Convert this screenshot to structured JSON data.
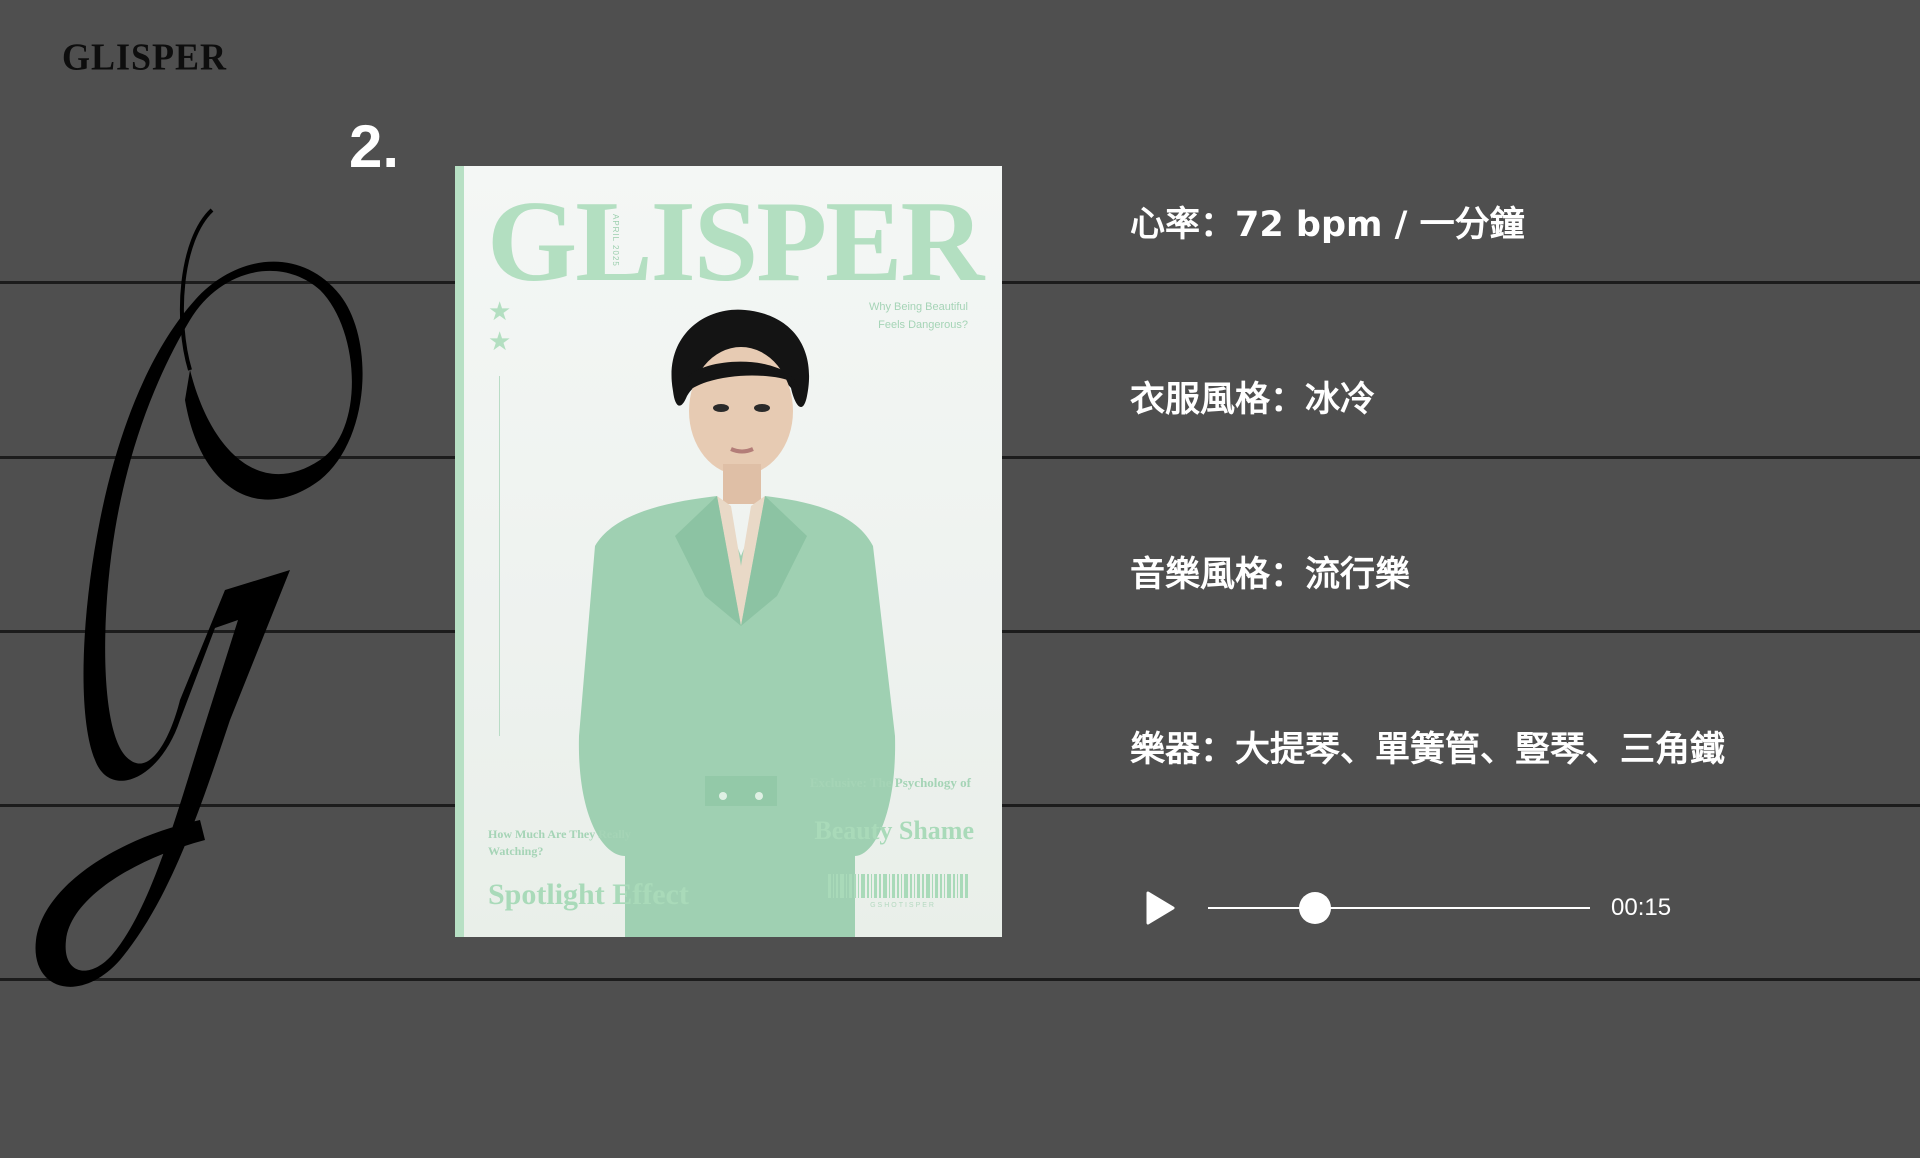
{
  "brand": "GLISPER",
  "item_number": "2.",
  "cover": {
    "title": "GLISPER",
    "date": "APRIL 2025",
    "teaser": "Why Being Beautiful Feels Dangerous?",
    "left_caption": "How Much Are They Really Watching?",
    "left_headline": "Spotlight Effect",
    "right_caption": "Exclusive: The Psychology of",
    "right_headline": "Beauty Shame",
    "barcode_text": "GSHOTISPER"
  },
  "info": {
    "heart_rate": "心率：72 bpm / 一分鐘",
    "clothing_style": "衣服風格：冰冷",
    "music_style": "音樂風格：流行樂",
    "instruments": "樂器：大提琴、單簧管、豎琴、三角鐵"
  },
  "player": {
    "state": "paused",
    "time": "00:15",
    "progress": 0.28
  },
  "colors": {
    "background": "#4f4f4f",
    "accent": "#b3dfc1",
    "suit": "#9fd0b2",
    "text": "#ffffff"
  }
}
